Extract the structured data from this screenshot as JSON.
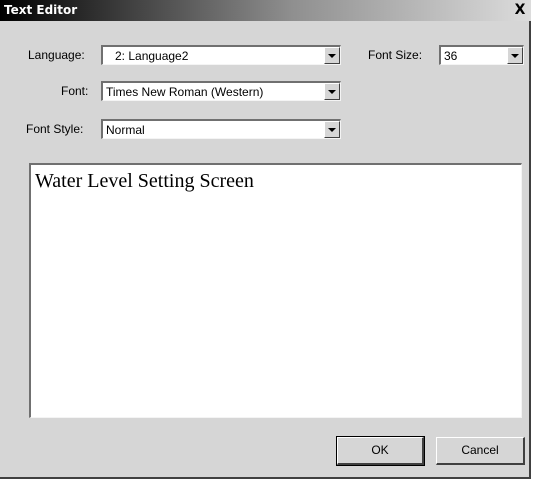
{
  "window": {
    "title": "Text Editor",
    "close_label": "X"
  },
  "language": {
    "label": "Language:",
    "value": "2: Language2"
  },
  "font_size": {
    "label": "Font Size:",
    "value": "36"
  },
  "font": {
    "label": "Font:",
    "value": "Times New Roman (Western)"
  },
  "font_style": {
    "label": "Font Style:",
    "value": "Normal"
  },
  "editor": {
    "text": "Water Level Setting Screen"
  },
  "buttons": {
    "ok": "OK",
    "cancel": "Cancel"
  },
  "icons": {
    "dropdown": "chevron-down-icon",
    "close": "close-icon"
  }
}
